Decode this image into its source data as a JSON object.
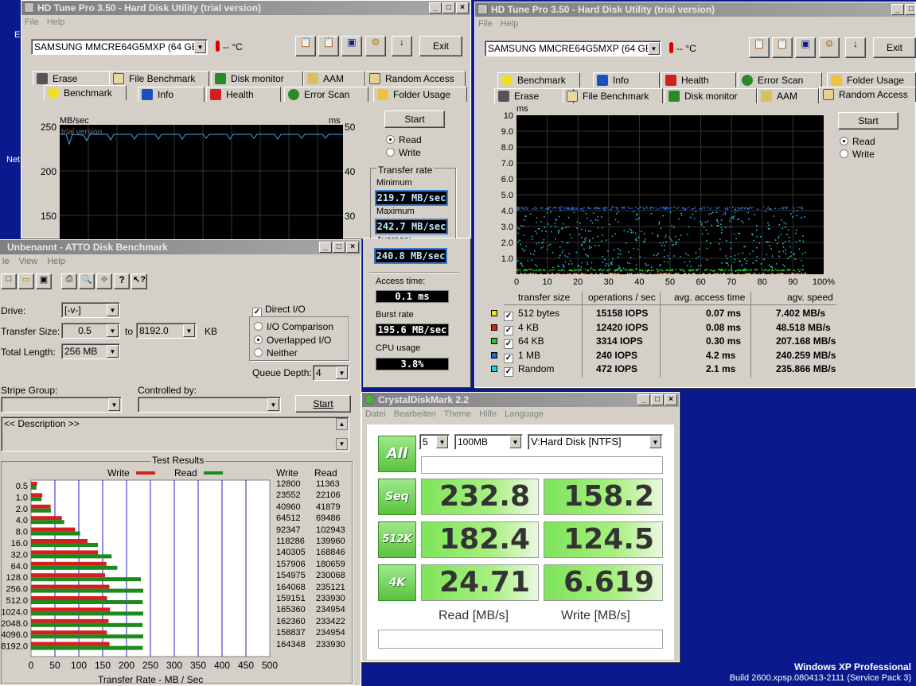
{
  "desktop": {
    "left_labels": [
      "E",
      "Net"
    ],
    "os_name": "Windows XP Professional",
    "os_build": "Build 2600.xpsp.080413-2111 (Service Pack 3)"
  },
  "hdtune1": {
    "title": "HD Tune Pro 3.50 - Hard Disk Utility (trial version)",
    "menu": [
      "File",
      "Help"
    ],
    "drive": "SAMSUNG MMCRE64G5MXP (64 GB)",
    "temp": "-- °C",
    "exit": "Exit",
    "tabs_row1": [
      "Erase",
      "File Benchmark",
      "Disk monitor",
      "AAM",
      "Random Access"
    ],
    "tabs_row2": [
      "Benchmark",
      "Info",
      "Health",
      "Error Scan",
      "Folder Usage"
    ],
    "start": "Start",
    "read": "Read",
    "write": "Write",
    "chart": {
      "ylabel": "MB/sec",
      "yticks": [
        "250",
        "200",
        "150"
      ],
      "y2label": "ms",
      "y2ticks": [
        "50",
        "40",
        "30"
      ],
      "watermark": "trial version"
    },
    "transfer_rate": "Transfer rate",
    "minimum_label": "Minimum",
    "minimum": "219.7 MB/sec",
    "maximum_label": "Maximum",
    "maximum": "242.7 MB/sec",
    "average_label": "Average:",
    "average": "240.8 MB/sec",
    "access_label": "Access time:",
    "access": "0.1 ms",
    "burst_label": "Burst rate",
    "burst": "195.6 MB/sec",
    "cpu_label": "CPU usage",
    "cpu": "3.8%"
  },
  "hdtune2": {
    "title": "HD Tune Pro 3.50 - Hard Disk Utility (trial version)",
    "menu": [
      "File",
      "Help"
    ],
    "drive": "SAMSUNG MMCRE64G5MXP (64 GB)",
    "temp": "-- °C",
    "exit": "Exit",
    "tabs_row1": [
      "Benchmark",
      "Info",
      "Health",
      "Error Scan",
      "Folder Usage"
    ],
    "tabs_row2": [
      "Erase",
      "File Benchmark",
      "Disk monitor",
      "AAM",
      "Random Access"
    ],
    "start": "Start",
    "read": "Read",
    "write": "Write",
    "chart_ylabel": "ms",
    "yticks": [
      "10",
      "9.0",
      "8.0",
      "7.0",
      "6.0",
      "5.0",
      "4.0",
      "3.0",
      "2.0",
      "1.0"
    ],
    "xticks": [
      "0",
      "10",
      "20",
      "30",
      "40",
      "50",
      "60",
      "70",
      "80",
      "90",
      "100%"
    ],
    "headers": [
      "transfer size",
      "operations / sec",
      "avg. access time",
      "agv. speed"
    ],
    "rows": [
      {
        "size": "512 bytes",
        "ops": "15158 IOPS",
        "time": "0.07 ms",
        "speed": "7.402 MB/s",
        "color": "#f0e020"
      },
      {
        "size": "4 KB",
        "ops": "12420 IOPS",
        "time": "0.08 ms",
        "speed": "48.518 MB/s",
        "color": "#d02020"
      },
      {
        "size": "64 KB",
        "ops": "3314 IOPS",
        "time": "0.30 ms",
        "speed": "207.168 MB/s",
        "color": "#30c030"
      },
      {
        "size": "1 MB",
        "ops": "240 IOPS",
        "time": "4.2 ms",
        "speed": "240.259 MB/s",
        "color": "#2060d0"
      },
      {
        "size": "Random",
        "ops": "472 IOPS",
        "time": "2.1 ms",
        "speed": "235.866 MB/s",
        "color": "#30c8d8"
      }
    ]
  },
  "atto": {
    "title": "Unbenannt - ATTO Disk Benchmark",
    "menu": [
      "le",
      "View",
      "Help"
    ],
    "drive_label": "Drive:",
    "drive": "[-v-]",
    "transfer_label": "Transfer Size:",
    "transfer_from": "0.5",
    "to": "to",
    "transfer_to": "8192.0",
    "kb": "KB",
    "total_label": "Total Length:",
    "total": "256 MB",
    "direct_io": "Direct I/O",
    "io_comparison": "I/O Comparison",
    "overlapped": "Overlapped I/O",
    "neither": "Neither",
    "queue_label": "Queue Depth:",
    "queue": "4",
    "stripe_label": "Stripe Group:",
    "controlled_label": "Controlled by:",
    "start": "Start",
    "description": "<< Description >>",
    "results_title": "Test Results",
    "write_legend": "Write",
    "read_legend": "Read",
    "col_write": "Write",
    "col_read": "Read",
    "xlabel": "Transfer Rate - MB / Sec"
  },
  "chart_data": {
    "type": "bar",
    "title": "Test Results",
    "xlabel": "Transfer Rate - MB / Sec",
    "xlim": [
      0,
      500
    ],
    "xticks": [
      "0",
      "50",
      "100",
      "150",
      "200",
      "250",
      "300",
      "350",
      "400",
      "450",
      "500"
    ],
    "categories": [
      "0.5",
      "1.0",
      "2.0",
      "4.0",
      "8.0",
      "16.0",
      "32.0",
      "64.0",
      "128.0",
      "256.0",
      "512.0",
      "1024.0",
      "2048.0",
      "4096.0",
      "8192.0"
    ],
    "series": [
      {
        "name": "Write",
        "values": [
          12800,
          23552,
          40960,
          64512,
          92347,
          118286,
          140305,
          157906,
          154975,
          164068,
          159151,
          165360,
          162360,
          158837,
          164348
        ],
        "color": "#d42020"
      },
      {
        "name": "Read",
        "values": [
          11363,
          22106,
          41879,
          69486,
          102943,
          139960,
          168846,
          180659,
          230068,
          235121,
          233930,
          234954,
          233422,
          234954,
          233930
        ],
        "color": "#1c8a1c"
      }
    ]
  },
  "cdm": {
    "title": "CrystalDiskMark 2.2",
    "menu": [
      "Datei",
      "Bearbeiten",
      "Theme",
      "Hilfe",
      "Language"
    ],
    "count": "5",
    "size": "100MB",
    "drive": "V:Hard Disk [NTFS]",
    "all": "All",
    "rows": [
      {
        "label": "Seq",
        "read": "232.8",
        "write": "158.2"
      },
      {
        "label": "512K",
        "read": "182.4",
        "write": "124.5"
      },
      {
        "label": "4K",
        "read": "24.71",
        "write": "6.619"
      }
    ],
    "read_label": "Read [MB/s]",
    "write_label": "Write [MB/s]"
  }
}
